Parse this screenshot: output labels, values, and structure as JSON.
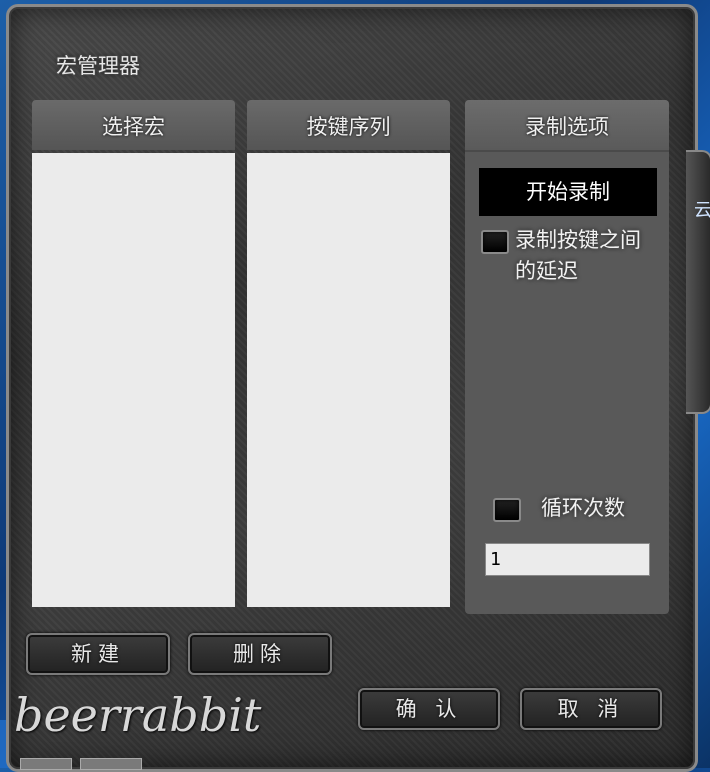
{
  "window": {
    "title": "宏管理器"
  },
  "panels": {
    "macros": {
      "header": "选择宏",
      "items": []
    },
    "sequence": {
      "header": "按键序列",
      "items": []
    },
    "record": {
      "header": "录制选项",
      "start_button": "开始录制",
      "delay_checkbox": {
        "label_line1": "录制按键之间",
        "label_line2": "的延迟",
        "checked": false
      },
      "loop_checkbox": {
        "label": "循环次数",
        "checked": false
      },
      "loop_count": "1"
    }
  },
  "buttons": {
    "new": "新建",
    "delete": "删除",
    "ok": "确 认",
    "cancel": "取 消"
  },
  "side": {
    "text": "云"
  },
  "watermark": "beerrabbit",
  "colors": {
    "accent_background": "#1a6fd0",
    "panel": "#595959",
    "list": "#ebebeb"
  }
}
